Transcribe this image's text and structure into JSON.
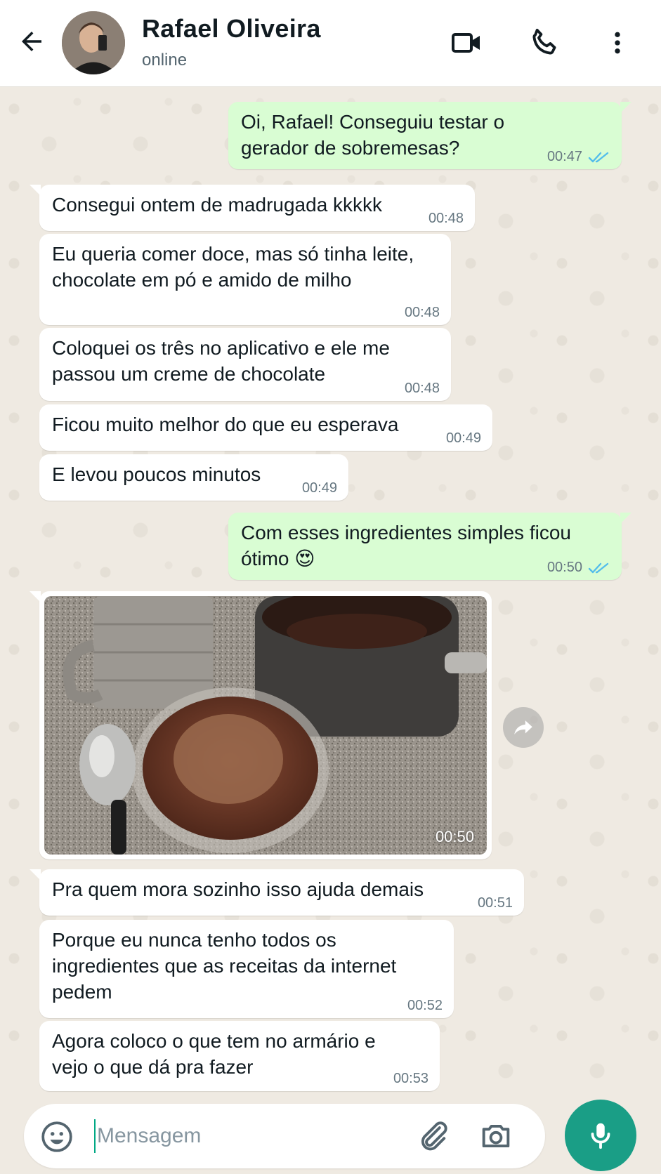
{
  "header": {
    "contact_name": "Rafael Oliveira",
    "status": "online",
    "icons": [
      "back-arrow-icon",
      "video-call-icon",
      "phone-icon",
      "more-vert-icon"
    ]
  },
  "messages": [
    {
      "dir": "out",
      "text": "Oi, Rafael! Conseguiu testar o gerador de sobremesas?",
      "time": "00:47",
      "status": "read"
    },
    {
      "dir": "in",
      "text": "Consegui ontem de madrugada kkkkk",
      "time": "00:48"
    },
    {
      "dir": "in",
      "text": "Eu queria comer doce, mas só tinha leite, chocolate em pó e amido de milho",
      "time": "00:48"
    },
    {
      "dir": "in",
      "text": "Coloquei os três no aplicativo e ele me passou um creme de chocolate",
      "time": "00:48"
    },
    {
      "dir": "in",
      "text": "Ficou muito melhor do que eu esperava",
      "time": "00:49"
    },
    {
      "dir": "in",
      "text": "E levou poucos minutos",
      "time": "00:49"
    },
    {
      "dir": "out",
      "text": "Com esses ingredientes simples ficou ótimo 😍",
      "time": "00:50",
      "status": "read"
    },
    {
      "dir": "in",
      "type": "image",
      "time": "00:50"
    },
    {
      "dir": "in",
      "text": "Pra quem mora sozinho isso ajuda demais",
      "time": "00:51"
    },
    {
      "dir": "in",
      "text": "Porque eu nunca tenho todos os ingredientes que as receitas da internet pedem",
      "time": "00:52"
    },
    {
      "dir": "in",
      "text": "Agora coloco o que tem no armário e vejo o que dá pra fazer",
      "time": "00:53"
    }
  ],
  "composer": {
    "placeholder": "Mensagem",
    "value": "",
    "icons": [
      "emoji-icon",
      "attach-icon",
      "camera-icon",
      "mic-icon"
    ]
  },
  "colors": {
    "outgoing_bubble": "#d9fdd3",
    "incoming_bubble": "#ffffff",
    "chat_background": "#efeae2",
    "accent": "#1a9e86",
    "read_ticks": "#53bdeb"
  }
}
